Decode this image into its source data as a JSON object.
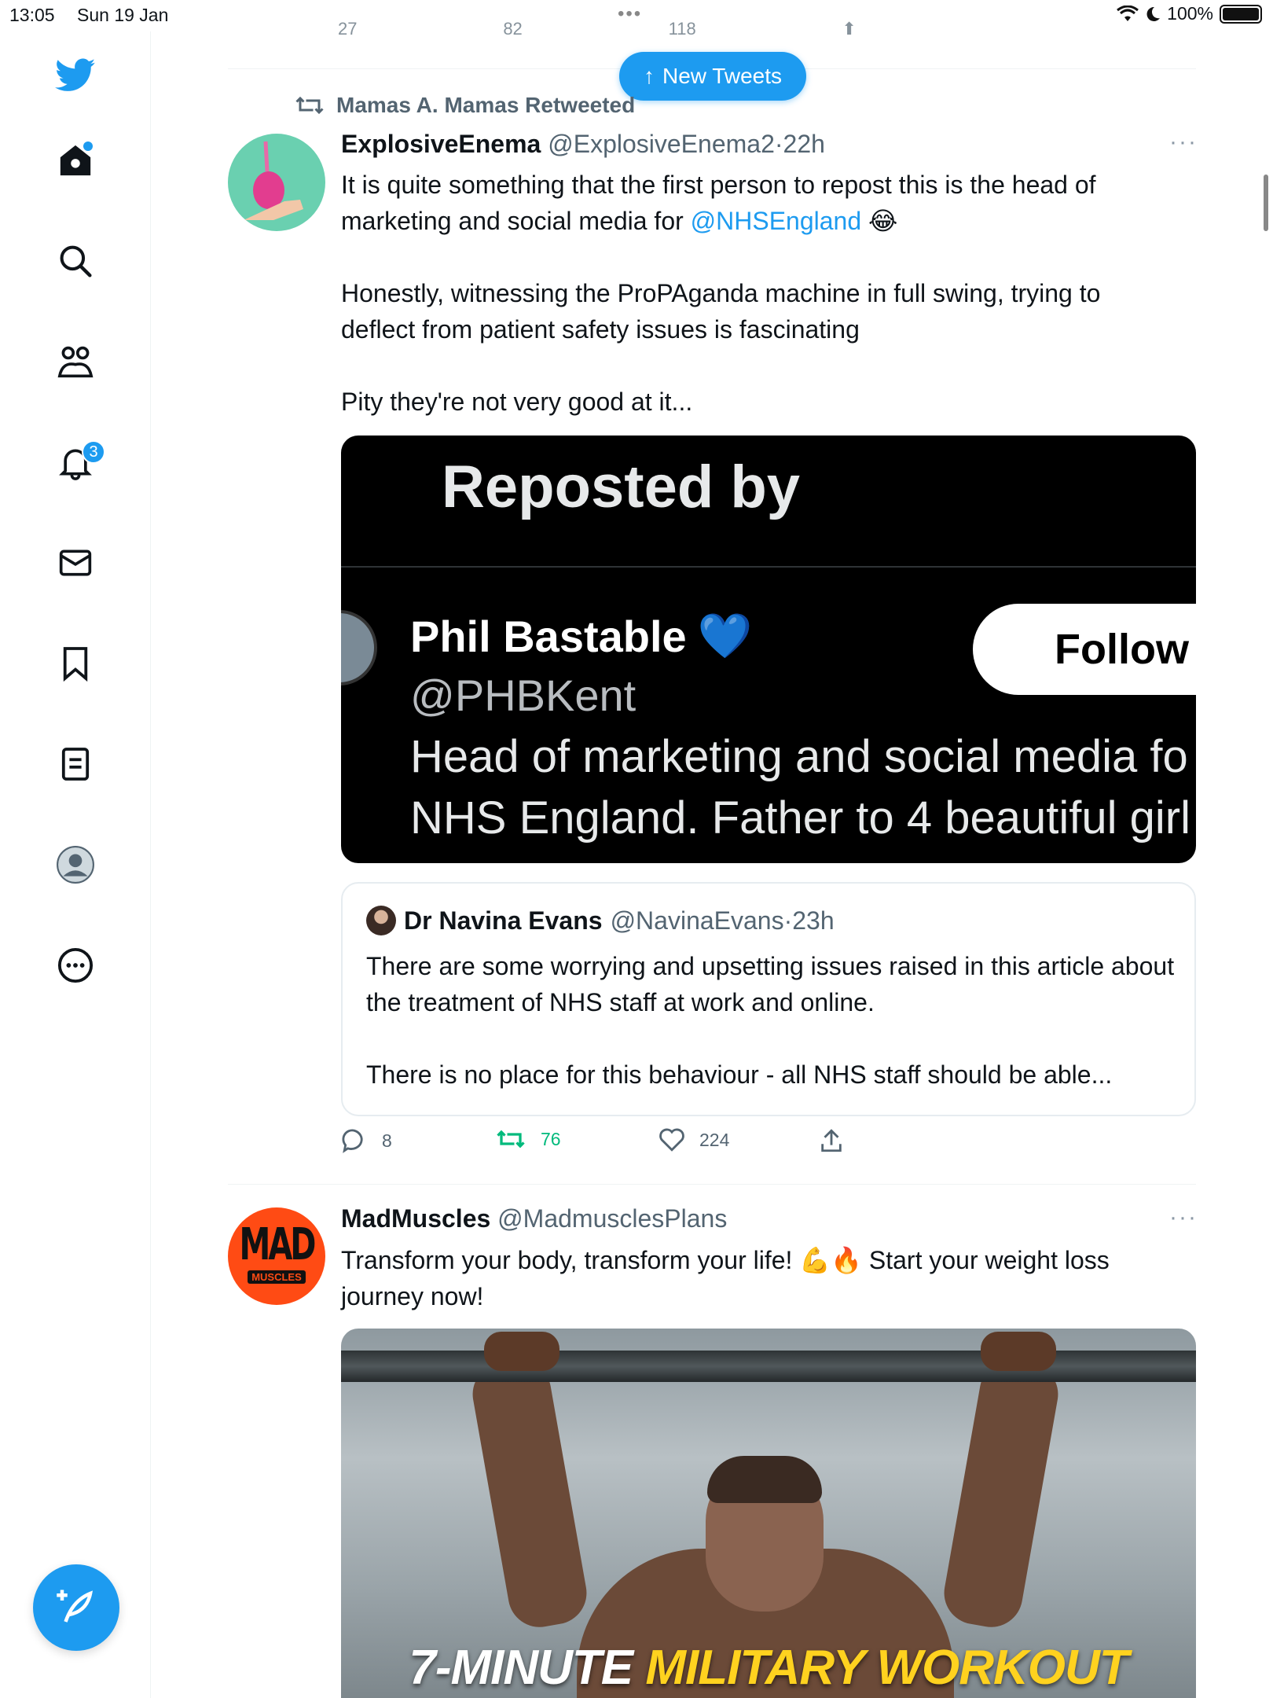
{
  "status_bar": {
    "time": "13:05",
    "date": "Sun 19 Jan",
    "battery": "100%"
  },
  "nav": {
    "notifications_badge": "3"
  },
  "banner": {
    "new_tweets_label": "New Tweets"
  },
  "previous_tweet_actions": {
    "replies": "27",
    "retweets": "82",
    "likes": "118"
  },
  "tweet1": {
    "retweeted_by": "Mamas A. Mamas Retweeted",
    "name": "ExplosiveEnema",
    "handle": "@ExplosiveEnema2",
    "dot": "·",
    "time": "22h",
    "text_line1_pre": "It is quite something that the first person to repost this is the head of marketing and social media for ",
    "mention": "@NHSEngland",
    "emoji": "😂",
    "paragraph2": "Honestly, witnessing the ProPAganda machine in full swing, trying to deflect from patient safety issues is fascinating",
    "paragraph3": "Pity they're not very good at it...",
    "image": {
      "header": "Reposted by",
      "profile_name": "Phil Bastable",
      "profile_heart": "💙",
      "profile_handle": "@PHBKent",
      "follow_label": "Follow",
      "bio_line1": "Head of marketing and social media fo",
      "bio_line2": "NHS England. Father to 4 beautiful girl"
    },
    "quote": {
      "name": "Dr Navina Evans",
      "handle": "@NavinaEvans",
      "dot": "·",
      "time": "23h",
      "paragraph1": "There are some worrying and upsetting issues raised in this article about the treatment of NHS staff at work and online.",
      "paragraph2": "There is no place for this behaviour - all NHS staff should be able..."
    },
    "actions": {
      "replies": "8",
      "retweets": "76",
      "likes": "224"
    }
  },
  "tweet2": {
    "avatar_line1": "MAD",
    "avatar_line2": "MUSCLES",
    "name": "MadMuscles",
    "handle": "@MadmusclesPlans",
    "text_pre": "Transform your body, transform your life! ",
    "emojis": "💪🔥",
    "text_post": " Start your weight loss journey now!",
    "image_caption_white": "7-MINUTE",
    "image_caption_yellow": "MILITARY WORKOUT"
  },
  "colors": {
    "accent": "#1d9bf0",
    "retweet_green": "#00ba7c",
    "muted": "#536471"
  }
}
